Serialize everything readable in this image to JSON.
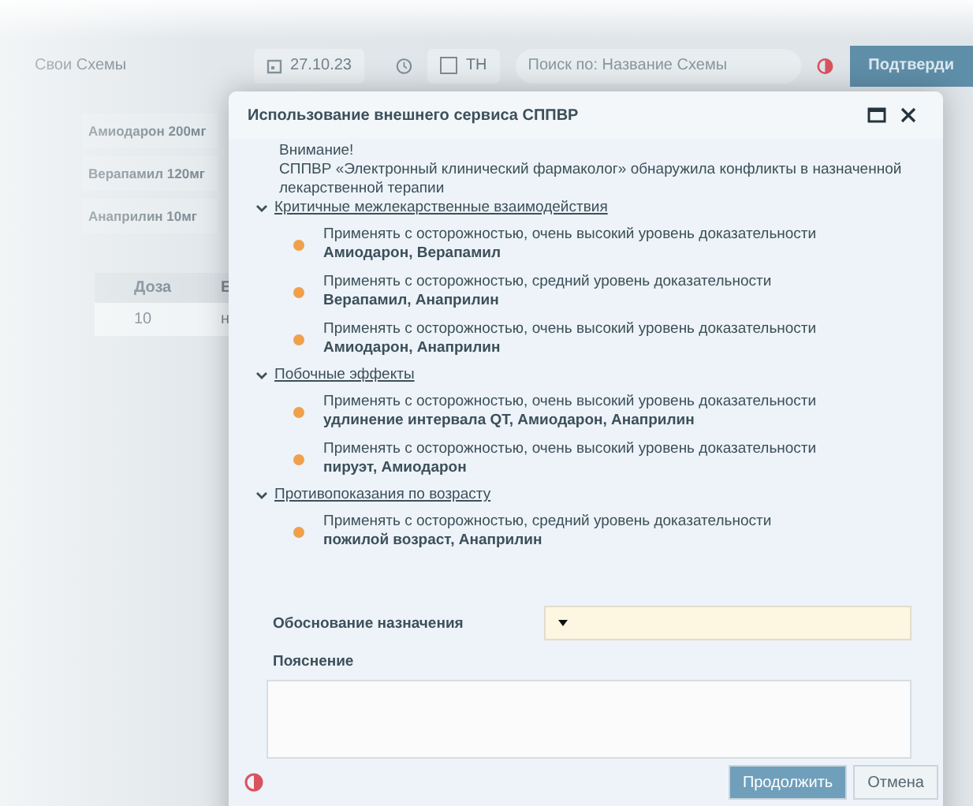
{
  "toolbar": {
    "schemes": "Свои Схемы",
    "date": "27.10.23",
    "tn": {
      "label": "ТН",
      "checked": false
    },
    "search": {
      "placeholder": "Поиск по: Название Схемы"
    },
    "confirm": "Подтверди"
  },
  "schemes": [
    "Амиодарон 200мг",
    "Верапамил 120мг",
    "Анаприлин 10мг"
  ],
  "table": {
    "columns": [
      "Доза",
      "Е"
    ],
    "rows": [
      [
        "10",
        "н"
      ]
    ]
  },
  "dialog": {
    "title": "Использование внешнего сервиса СППВР",
    "notice_title": "Внимание!",
    "notice": "СППВР «Электронный клинический фармаколог» обнаружила конфликты в назначенной лекарственной терапии",
    "sections": [
      {
        "title": "Критичные межлекарственные взаимодействия",
        "expanded": true,
        "items": [
          {
            "text": "Применять с осторожностью, очень высокий уровень доказательности",
            "subject": "Амиодарон, Верапамил",
            "color": "#f0a04b"
          },
          {
            "text": "Применять с осторожностью, средний уровень доказательности",
            "subject": "Верапамил, Анаприлин",
            "color": "#f0a04b"
          },
          {
            "text": "Применять с осторожностью, очень высокий уровень доказательности",
            "subject": "Амиодарон, Анаприлин",
            "color": "#f0a04b"
          }
        ]
      },
      {
        "title": "Побочные эффекты",
        "expanded": true,
        "items": [
          {
            "text": "Применять с осторожностью, очень высокий уровень доказательности",
            "subject": "удлинение интервала QT, Амиодарон, Анаприлин",
            "color": "#f0a04b"
          },
          {
            "text": "Применять с осторожностью, очень высокий уровень доказательности",
            "subject": "пируэт, Амиодарон",
            "color": "#f0a04b"
          }
        ]
      },
      {
        "title": "Противопоказания по возрасту",
        "expanded": true,
        "items": [
          {
            "text": "Применять с осторожностью, средний уровень доказательности",
            "subject": "пожилой возраст, Анаприлин",
            "color": "#f0a04b"
          }
        ]
      }
    ],
    "reason_label": "Обоснование назначения",
    "comment_label": "Пояснение",
    "buttons": [
      "Продолжить",
      "Отмена"
    ]
  }
}
